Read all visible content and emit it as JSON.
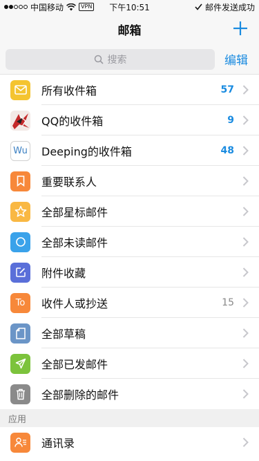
{
  "status": {
    "carrier": "中国移动",
    "vpn": "VPN",
    "time": "下午10:51",
    "message": "邮件发送成功"
  },
  "nav": {
    "title": "邮箱"
  },
  "search": {
    "placeholder": "搜索",
    "edit": "编辑"
  },
  "mailboxes": [
    {
      "label": "所有收件箱",
      "count": "57",
      "count_style": "blue",
      "icon": "inbox-icon",
      "color": "#f4c430"
    },
    {
      "label": "QQ的收件箱",
      "count": "9",
      "count_style": "blue",
      "icon": "qq-avatar-icon",
      "color": "#c4292a"
    },
    {
      "label": "Deeping的收件箱",
      "count": "48",
      "count_style": "blue",
      "icon": "wu-avatar-icon",
      "color": "#ffffff",
      "icon_text": "Wu"
    },
    {
      "label": "重要联系人",
      "count": "",
      "count_style": "",
      "icon": "bookmark-icon",
      "color": "#f7883a"
    },
    {
      "label": "全部星标邮件",
      "count": "",
      "count_style": "",
      "icon": "star-icon",
      "color": "#f9b843"
    },
    {
      "label": "全部未读邮件",
      "count": "",
      "count_style": "",
      "icon": "circle-icon",
      "color": "#3aa2ea"
    },
    {
      "label": "附件收藏",
      "count": "",
      "count_style": "",
      "icon": "attachment-edit-icon",
      "color": "#5a6fd9"
    },
    {
      "label": "收件人或抄送",
      "count": "15",
      "count_style": "gray",
      "icon": "to-cc-icon",
      "color": "#f7883a",
      "icon_text": "To"
    },
    {
      "label": "全部草稿",
      "count": "",
      "count_style": "",
      "icon": "draft-icon",
      "color": "#6b95c7"
    },
    {
      "label": "全部已发邮件",
      "count": "",
      "count_style": "",
      "icon": "send-icon",
      "color": "#7cc33c"
    },
    {
      "label": "全部删除的邮件",
      "count": "",
      "count_style": "",
      "icon": "trash-icon",
      "color": "#8a8a8a"
    }
  ],
  "apps_section": {
    "title": "应用"
  },
  "apps": [
    {
      "label": "通讯录",
      "icon": "contacts-icon",
      "color": "#f7883a"
    }
  ],
  "colors": {
    "accent": "#1a8be0"
  }
}
